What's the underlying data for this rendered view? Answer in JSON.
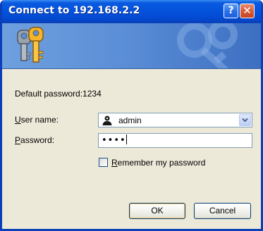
{
  "window": {
    "title": "Connect to 192.168.2.2",
    "help_label": "?",
    "close_label": "✕"
  },
  "banner": {
    "icon": "keys-icon"
  },
  "form": {
    "hint": "Default password:1234",
    "username_label_key": "U",
    "username_label_rest": "ser name:",
    "username_value": "admin",
    "password_label_key": "P",
    "password_label_rest": "assword:",
    "password_value": "••••",
    "remember_label_key": "R",
    "remember_label_rest": "emember my password",
    "remember_checked": false
  },
  "buttons": {
    "ok": "OK",
    "cancel": "Cancel"
  },
  "colors": {
    "titlebar": "#0452dc",
    "window_bg": "#ece9d8",
    "banner": "#5b8fd6"
  }
}
